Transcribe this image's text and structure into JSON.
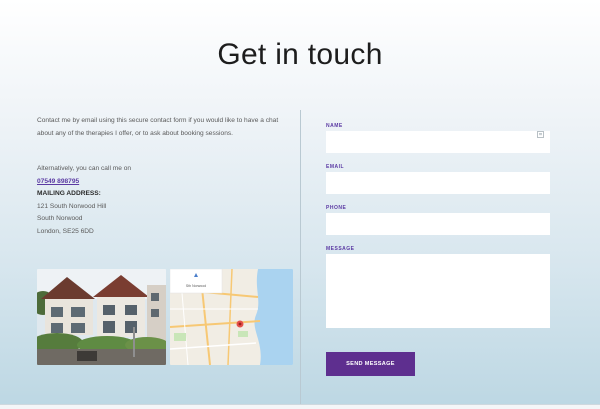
{
  "page": {
    "title": "Get in touch"
  },
  "contact": {
    "intro": "Contact me by email using this secure contact form if you would like to have a chat about any of the therapies I offer, or to ask about booking sessions.",
    "alt_text": "Alternatively, you can call me on",
    "phone": "07549 898795",
    "mailing_heading": "MAILING ADDRESS:",
    "address_lines": [
      "121 South Norwood Hill",
      "South Norwood",
      "London, SE25 6DD"
    ]
  },
  "map": {
    "label": "Sth Norwood",
    "pin_color": "#e3504a"
  },
  "form": {
    "name_label": "NAME",
    "email_label": "EMAIL",
    "phone_label": "PHONE",
    "message_label": "MESSAGE",
    "submit_label": "SEND MESSAGE",
    "name_value": "",
    "email_value": "",
    "phone_value": "",
    "message_value": ""
  },
  "colors": {
    "accent": "#5e2f8f",
    "link": "#5b3aa3"
  }
}
